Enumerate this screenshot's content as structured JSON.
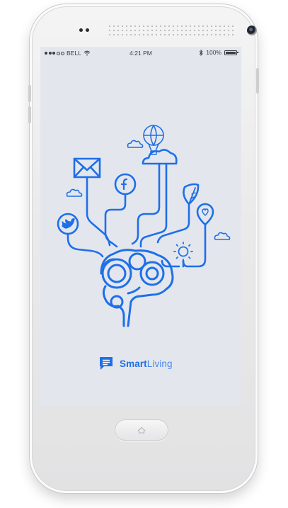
{
  "status_bar": {
    "carrier": "BELL",
    "time": "4:21 PM",
    "battery_text": "100%",
    "battery_level": 1.0
  },
  "brand": {
    "name_bold": "Smart",
    "name_light": "Living",
    "color": "#1f6fe8"
  },
  "icons": {
    "mail": "envelope-icon",
    "facebook": "facebook-icon",
    "twitter": "twitter-bird-icon",
    "leaf": "leaf-icon",
    "heart_pin": "heart-location-pin-icon",
    "sun": "sun-icon",
    "balloon": "hot-air-balloon-icon",
    "brain": "brain-icon",
    "chat": "chat-bubble-icon",
    "home": "home-icon"
  },
  "colors": {
    "accent": "#1f6fe8",
    "screen_bg": "#e3e7ed",
    "cloud": "#3b7cf0"
  }
}
